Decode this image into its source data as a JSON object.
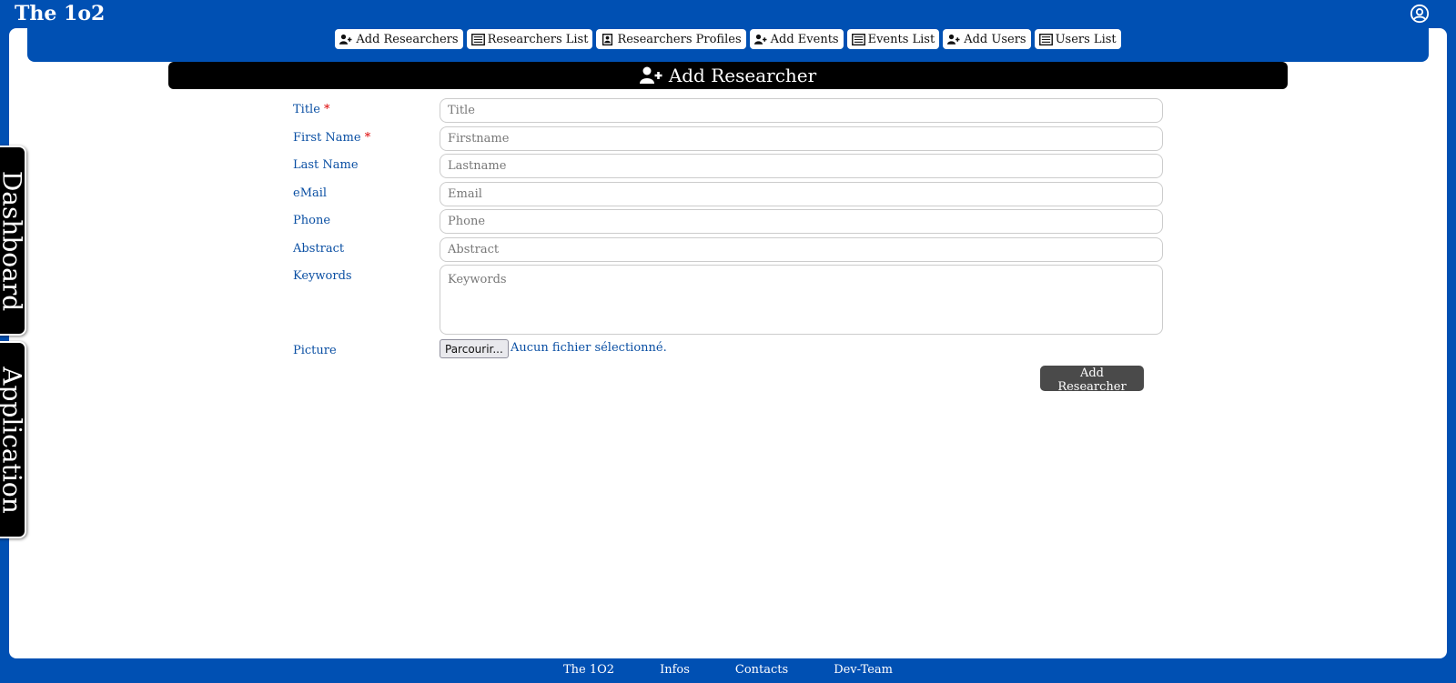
{
  "app": {
    "title": "The 1o2"
  },
  "nav": {
    "items": [
      {
        "label": "Add Researchers",
        "icon": "user-plus-icon"
      },
      {
        "label": "Researchers List",
        "icon": "list-icon"
      },
      {
        "label": "Researchers Profiles",
        "icon": "id-card-icon"
      },
      {
        "label": "Add Events",
        "icon": "user-plus-icon"
      },
      {
        "label": "Events List",
        "icon": "list-icon"
      },
      {
        "label": "Add Users",
        "icon": "user-plus-icon"
      },
      {
        "label": "Users List",
        "icon": "list-icon"
      }
    ]
  },
  "side_tabs": {
    "dashboard": "Dashboard",
    "application": "Application"
  },
  "form": {
    "header": "Add Researcher",
    "fields": {
      "title": {
        "label": "Title",
        "required": "*",
        "placeholder": "Title",
        "value": ""
      },
      "first_name": {
        "label": "First Name",
        "required": "*",
        "placeholder": "Firstname",
        "value": ""
      },
      "last_name": {
        "label": "Last Name",
        "placeholder": "Lastname",
        "value": ""
      },
      "email": {
        "label": "eMail",
        "placeholder": "Email",
        "value": ""
      },
      "phone": {
        "label": "Phone",
        "placeholder": "Phone",
        "value": ""
      },
      "abstract": {
        "label": "Abstract",
        "placeholder": "Abstract",
        "value": ""
      },
      "keywords": {
        "label": "Keywords",
        "placeholder": "Keywords",
        "value": ""
      },
      "picture": {
        "label": "Picture",
        "browse_label": "Parcourir...",
        "status": "Aucun fichier sélectionné."
      }
    },
    "submit_label": "Add Researcher"
  },
  "footer": {
    "links": [
      "The 1O2",
      "Infos",
      "Contacts",
      "Dev-Team"
    ]
  },
  "colors": {
    "brand_blue": "#0050b3",
    "label_blue": "#0a4fa3",
    "required_red": "#dd0000"
  }
}
